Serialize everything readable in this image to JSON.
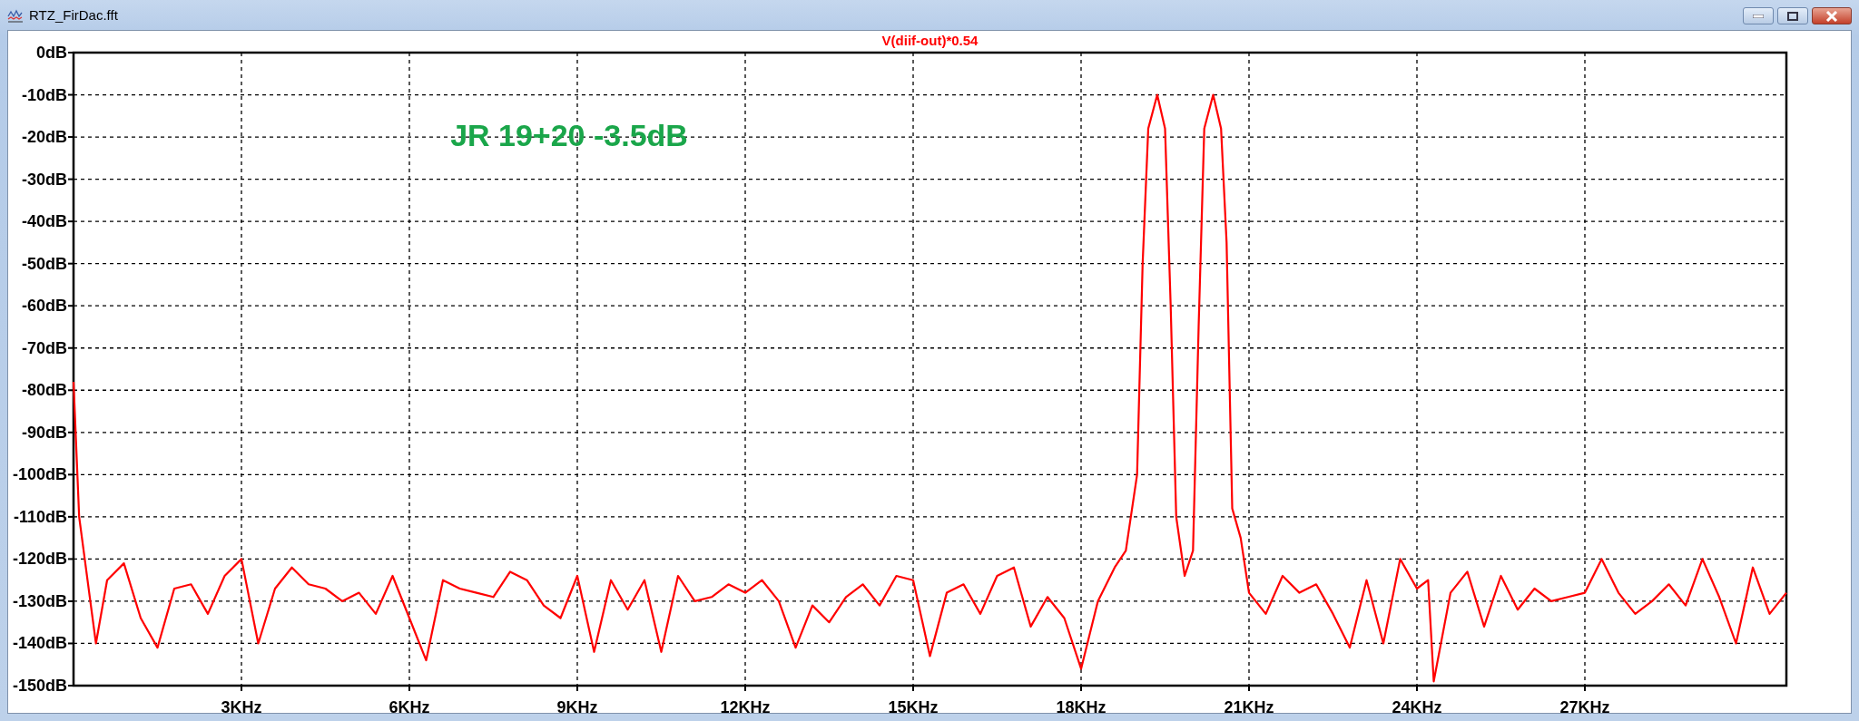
{
  "window": {
    "title": "RTZ_FirDac.fft"
  },
  "plot": {
    "chart_data": {
      "type": "line",
      "x": [
        0,
        0.1,
        0.3,
        0.4,
        0.6,
        0.9,
        1.2,
        1.5,
        1.8,
        2.1,
        2.4,
        2.7,
        3.0,
        3.3,
        3.6,
        3.9,
        4.2,
        4.5,
        4.8,
        5.1,
        5.4,
        5.7,
        6.0,
        6.3,
        6.6,
        6.9,
        7.2,
        7.5,
        7.8,
        8.1,
        8.4,
        8.7,
        9.0,
        9.3,
        9.6,
        9.9,
        10.2,
        10.5,
        10.8,
        11.1,
        11.4,
        11.7,
        12.0,
        12.3,
        12.6,
        12.9,
        13.2,
        13.5,
        13.8,
        14.1,
        14.4,
        14.7,
        15.0,
        15.3,
        15.6,
        15.9,
        16.2,
        16.5,
        16.8,
        17.1,
        17.4,
        17.7,
        18.0,
        18.3,
        18.6,
        18.8,
        19.0,
        19.1,
        19.2,
        19.36,
        19.5,
        19.6,
        19.7,
        19.85,
        20.0,
        20.1,
        20.2,
        20.36,
        20.5,
        20.6,
        20.7,
        20.85,
        21.0,
        21.3,
        21.6,
        21.9,
        22.2,
        22.5,
        22.8,
        23.1,
        23.4,
        23.7,
        24.0,
        24.2,
        24.3,
        24.6,
        24.9,
        25.2,
        25.5,
        25.8,
        26.1,
        26.4,
        26.7,
        27.0,
        27.3,
        27.6,
        27.9,
        28.2,
        28.5,
        28.8,
        29.1,
        29.4,
        29.7,
        30.0,
        30.3,
        30.6
      ],
      "series": [
        {
          "name": "V(diif-out)*0.54",
          "color": "#ff0000",
          "values": [
            -78,
            -110,
            -130,
            -140,
            -125,
            -121,
            -134,
            -141,
            -127,
            -126,
            -133,
            -124,
            -120,
            -140,
            -127,
            -122,
            -126,
            -127,
            -130,
            -128,
            -133,
            -124,
            -134,
            -144,
            -125,
            -127,
            -128,
            -129,
            -123,
            -125,
            -131,
            -134,
            -124,
            -142,
            -125,
            -132,
            -125,
            -142,
            -124,
            -130,
            -129,
            -126,
            -128,
            -125,
            -130,
            -141,
            -131,
            -135,
            -129,
            -126,
            -131,
            -124,
            -125,
            -143,
            -128,
            -126,
            -133,
            -124,
            -122,
            -136,
            -129,
            -134,
            -146,
            -130,
            -122,
            -118,
            -100,
            -50,
            -18,
            -10,
            -18,
            -60,
            -110,
            -124,
            -118,
            -65,
            -18,
            -10,
            -18,
            -45,
            -108,
            -115,
            -128,
            -133,
            -124,
            -128,
            -126,
            -133,
            -141,
            -125,
            -140,
            -120,
            -127,
            -125,
            -149,
            -128,
            -123,
            -136,
            -124,
            -132,
            -127,
            -130,
            -129,
            -128,
            -120,
            -128,
            -133,
            -130,
            -126,
            -131,
            -120,
            -129,
            -140,
            -122,
            -133,
            -128
          ]
        }
      ],
      "xlim": [
        0,
        30.6
      ],
      "ylim": [
        -150,
        0
      ],
      "xticks": [
        {
          "value": 3,
          "label": "3KHz"
        },
        {
          "value": 6,
          "label": "6KHz"
        },
        {
          "value": 9,
          "label": "9KHz"
        },
        {
          "value": 12,
          "label": "12KHz"
        },
        {
          "value": 15,
          "label": "15KHz"
        },
        {
          "value": 18,
          "label": "18KHz"
        },
        {
          "value": 21,
          "label": "21KHz"
        },
        {
          "value": 24,
          "label": "24KHz"
        },
        {
          "value": 27,
          "label": "27KHz"
        }
      ],
      "yticks": [
        {
          "value": 0,
          "label": "0dB"
        },
        {
          "value": -10,
          "label": "-10dB"
        },
        {
          "value": -20,
          "label": "-20dB"
        },
        {
          "value": -30,
          "label": "-30dB"
        },
        {
          "value": -40,
          "label": "-40dB"
        },
        {
          "value": -50,
          "label": "-50dB"
        },
        {
          "value": -60,
          "label": "-60dB"
        },
        {
          "value": -70,
          "label": "-70dB"
        },
        {
          "value": -80,
          "label": "-80dB"
        },
        {
          "value": -90,
          "label": "-90dB"
        },
        {
          "value": -100,
          "label": "-100dB"
        },
        {
          "value": -110,
          "label": "-110dB"
        },
        {
          "value": -120,
          "label": "-120dB"
        },
        {
          "value": -130,
          "label": "-130dB"
        },
        {
          "value": -140,
          "label": "-140dB"
        },
        {
          "value": -150,
          "label": "-150dB"
        }
      ],
      "grid": true,
      "annotations": [
        "JR 19+20 -3.5dB"
      ]
    }
  }
}
